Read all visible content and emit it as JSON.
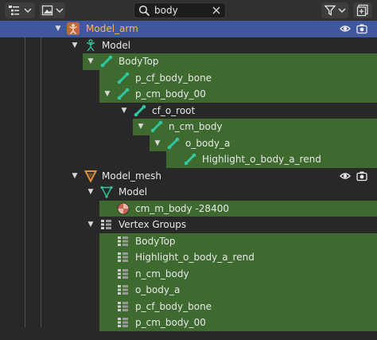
{
  "search": {
    "value": "body"
  },
  "colors": {
    "bone": "#2fc7a0",
    "armature": "#e0a070",
    "mesh": "#e58f3a",
    "material": "#d4716a",
    "selected_text": "#ffb84a",
    "match_bg": "#3e6a30"
  },
  "header_icons": [
    "outliner-display-mode-icon",
    "filter-icon",
    "new-collection-icon"
  ],
  "tree": {
    "model_arm": "Model_arm",
    "model": "Model",
    "bodytop": "BodyTop",
    "p_cf_body_bone": "p_cf_body_bone",
    "p_cm_body_00": "p_cm_body_00",
    "cf_o_root": "cf_o_root",
    "n_cm_body": "n_cm_body",
    "o_body_a": "o_body_a",
    "highlight_o_body_a_rend": "Highlight_o_body_a_rend",
    "model_mesh": "Model_mesh",
    "mesh_model": "Model",
    "material": "cm_m_body -28400",
    "vertex_groups": "Vertex Groups",
    "vg": [
      "BodyTop",
      "Highlight_o_body_a_rend",
      "n_cm_body",
      "o_body_a",
      "p_cf_body_bone",
      "p_cm_body_00"
    ]
  }
}
